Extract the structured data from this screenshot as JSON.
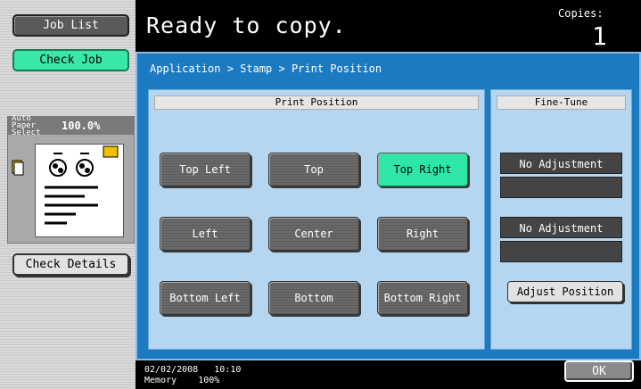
{
  "left": {
    "job_list": "Job List",
    "check_job": "Check Job",
    "auto_paper": "Auto Paper Select",
    "zoom": "100.0%",
    "check_details": "Check Details"
  },
  "header": {
    "status": "Ready to copy.",
    "copies_label": "Copies:",
    "copies_count": "1"
  },
  "breadcrumb": "Application > Stamp > Print Position",
  "print_position": {
    "title": "Print Position",
    "buttons": [
      {
        "label": "Top Left",
        "selected": false
      },
      {
        "label": "Top",
        "selected": false
      },
      {
        "label": "Top Right",
        "selected": true
      },
      {
        "label": "Left",
        "selected": false
      },
      {
        "label": "Center",
        "selected": false
      },
      {
        "label": "Right",
        "selected": false
      },
      {
        "label": "Bottom Left",
        "selected": false
      },
      {
        "label": "Bottom",
        "selected": false
      },
      {
        "label": "Bottom Right",
        "selected": false
      }
    ]
  },
  "fine_tune": {
    "title": "Fine-Tune",
    "horizontal": "No Adjustment",
    "vertical": "No Adjustment",
    "adjust_button": "Adjust Position"
  },
  "footer": {
    "date": "02/02/2008",
    "time": "10:10",
    "memory_label": "Memory",
    "memory_value": "100%",
    "ok": "OK"
  },
  "colors": {
    "accent_blue": "#1c7ac0",
    "selected_green": "#2ee6a6"
  }
}
